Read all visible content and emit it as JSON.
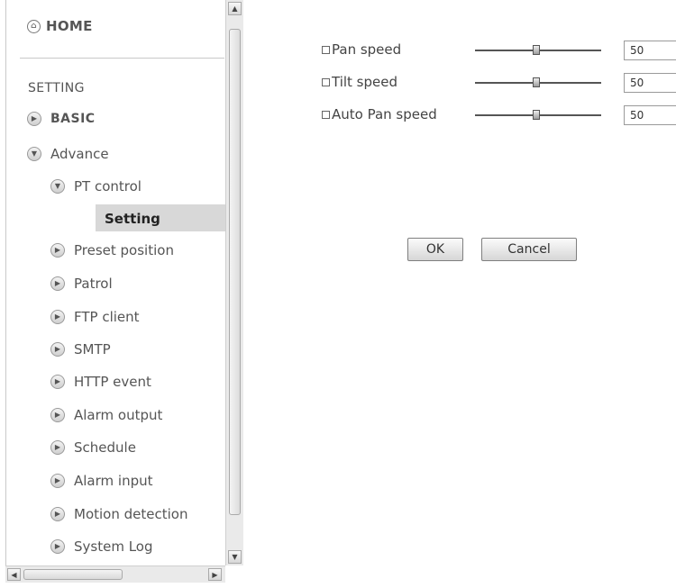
{
  "nav": {
    "home_label": "HOME",
    "setting_heading": "SETTING",
    "items": {
      "basic": "BASIC",
      "advance": "Advance",
      "pt_control": "PT control",
      "setting": "Setting",
      "preset_position": "Preset position",
      "patrol": "Patrol",
      "ftp_client": "FTP client",
      "smtp": "SMTP",
      "http_event": "HTTP event",
      "alarm_output": "Alarm output",
      "schedule": "Schedule",
      "alarm_input": "Alarm input",
      "motion_detection": "Motion detection",
      "system_log": "System Log"
    },
    "icons": {
      "home": "home-icon",
      "expand": "arrow-right-icon",
      "collapse": "arrow-down-icon"
    }
  },
  "pt_settings": {
    "pan_speed": {
      "label": "Pan speed",
      "value": "50",
      "slider_fraction": 0.5
    },
    "tilt_speed": {
      "label": "Tilt speed",
      "value": "50",
      "slider_fraction": 0.5
    },
    "auto_pan_speed": {
      "label": "Auto Pan speed",
      "value": "50",
      "slider_fraction": 0.5
    }
  },
  "buttons": {
    "ok": "OK",
    "cancel": "Cancel"
  },
  "colors": {
    "selected_background": "#d8d8d8",
    "nav_text": "#555555"
  }
}
